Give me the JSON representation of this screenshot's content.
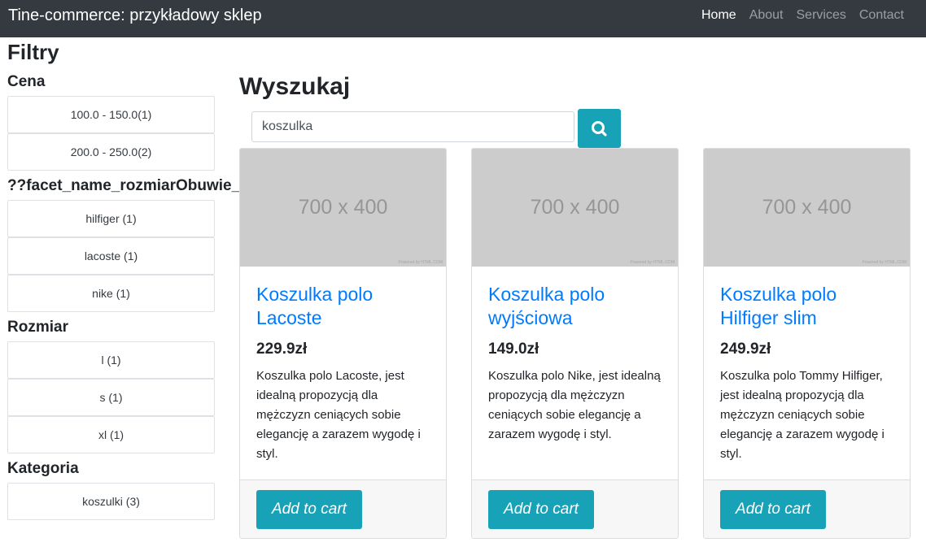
{
  "navbar": {
    "brand": "Tine-commerce: przykładowy sklep",
    "links": [
      "Home",
      "About",
      "Services",
      "Contact"
    ]
  },
  "filters": {
    "title": "Filtry",
    "facets": [
      {
        "title": "Cena",
        "options": [
          "100.0 - 150.0(1)",
          "200.0 - 250.0(2)"
        ]
      },
      {
        "title": "??facet_name_rozmiarObuwie_t",
        "options": [
          "hilfiger (1)",
          "lacoste (1)",
          "nike (1)"
        ]
      },
      {
        "title": "Rozmiar",
        "options": [
          "l (1)",
          "s (1)",
          "xl (1)"
        ]
      },
      {
        "title": "Kategoria",
        "options": [
          "koszulki (3)"
        ]
      }
    ]
  },
  "search": {
    "title": "Wyszukaj",
    "value": "koszulka",
    "button_icon": "search-icon"
  },
  "products": [
    {
      "image_label": "700 x 400",
      "image_credit": "Powered by HTML.COM",
      "title": "Koszulka polo Lacoste",
      "price": "229.9zł",
      "description": "Koszulka polo Lacoste, jest idealną propozycją dla mężczyzn ceniących sobie elegancję a zarazem wygodę i styl.",
      "cart_label": "Add to cart"
    },
    {
      "image_label": "700 x 400",
      "image_credit": "Powered by HTML.COM",
      "title": "Koszulka polo wyjściowa",
      "price": "149.0zł",
      "description": "Koszulka polo Nike, jest idealną propozycją dla mężczyzn ceniących sobie elegancję a zarazem wygodę i styl.",
      "cart_label": "Add to cart"
    },
    {
      "image_label": "700 x 400",
      "image_credit": "Powered by HTML.COM",
      "title": "Koszulka polo Hilfiger slim",
      "price": "249.9zł",
      "description": "Koszulka polo Tommy Hilfiger, jest idealną propozycją dla mężczyzn ceniących sobie elegancję a zarazem wygodę i styl.",
      "cart_label": "Add to cart"
    }
  ],
  "colors": {
    "navbar_bg": "#343a40",
    "accent": "#17a2b8",
    "link": "#007bff"
  }
}
